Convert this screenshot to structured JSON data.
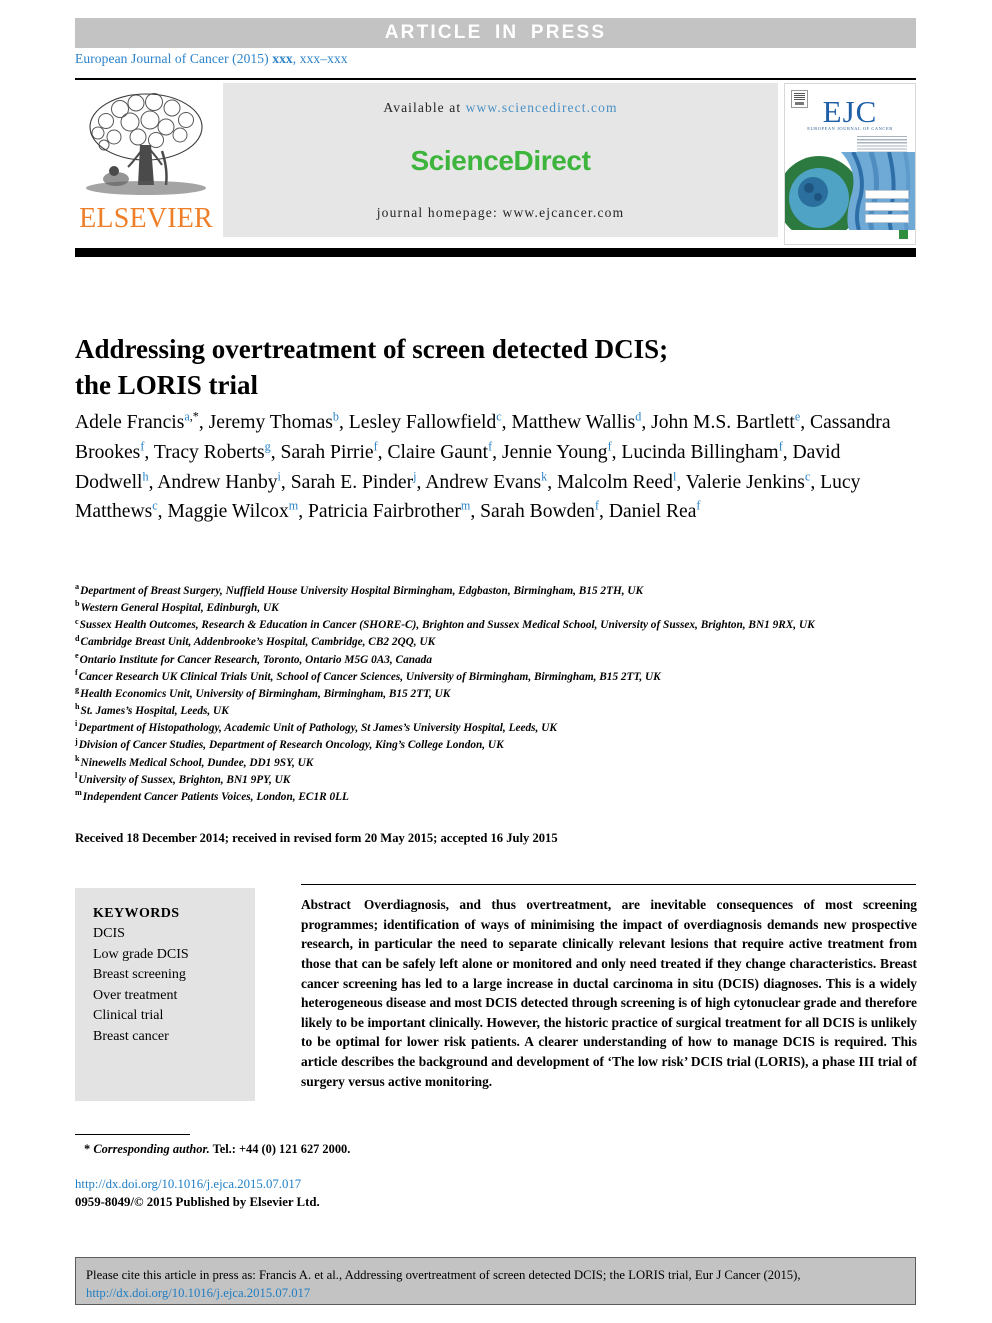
{
  "banner": {
    "text": "ARTICLE  IN  PRESS"
  },
  "journal_ref": {
    "prefix": "European Journal of Cancer (2015) ",
    "bold": "xxx",
    "suffix": ", xxx–xxx"
  },
  "masthead": {
    "publisher": "ELSEVIER",
    "available_label": "Available at ",
    "available_url": "www.sciencedirect.com",
    "sciencedirect_logo": "ScienceDirect",
    "homepage": "journal homepage: www.ejcancer.com",
    "cover": {
      "title": "EJC",
      "subtitle": "EUROPEAN JOURNAL OF CANCER"
    },
    "colors": {
      "elsevier_orange": "#ee7f28",
      "sciencedirect_green": "#3db53d",
      "link_blue": "#4a90c4",
      "ejc_blue": "#1f5fa8",
      "banner_grey": "#c3c3c3",
      "panel_grey": "#e6e6e6"
    }
  },
  "article": {
    "title_line1": "Addressing overtreatment of screen detected DCIS;",
    "title_line2": "the LORIS trial"
  },
  "authors": [
    {
      "name": "Adele Francis",
      "sup": "a",
      "star": true
    },
    {
      "name": "Jeremy Thomas",
      "sup": "b"
    },
    {
      "name": "Lesley Fallowfield",
      "sup": "c"
    },
    {
      "name": "Matthew Wallis",
      "sup": "d"
    },
    {
      "name": "John M.S. Bartlett",
      "sup": "e"
    },
    {
      "name": "Cassandra Brookes",
      "sup": "f"
    },
    {
      "name": "Tracy Roberts",
      "sup": "g"
    },
    {
      "name": "Sarah Pirrie",
      "sup": "f"
    },
    {
      "name": "Claire Gaunt",
      "sup": "f"
    },
    {
      "name": "Jennie Young",
      "sup": "f"
    },
    {
      "name": "Lucinda Billingham",
      "sup": "f"
    },
    {
      "name": "David Dodwell",
      "sup": "h"
    },
    {
      "name": "Andrew Hanby",
      "sup": "i"
    },
    {
      "name": "Sarah E. Pinder",
      "sup": "j"
    },
    {
      "name": "Andrew Evans",
      "sup": "k"
    },
    {
      "name": "Malcolm Reed",
      "sup": "l"
    },
    {
      "name": "Valerie Jenkins",
      "sup": "c"
    },
    {
      "name": "Lucy Matthews",
      "sup": "c"
    },
    {
      "name": "Maggie Wilcox",
      "sup": "m"
    },
    {
      "name": "Patricia Fairbrother",
      "sup": "m"
    },
    {
      "name": "Sarah Bowden",
      "sup": "f"
    },
    {
      "name": "Daniel Rea",
      "sup": "f"
    }
  ],
  "affiliations": [
    {
      "key": "a",
      "text": "Department of Breast Surgery, Nuffield House University Hospital Birmingham, Edgbaston, Birmingham, B15 2TH, UK"
    },
    {
      "key": "b",
      "text": "Western General Hospital, Edinburgh, UK"
    },
    {
      "key": "c",
      "text": "Sussex Health Outcomes, Research & Education in Cancer (SHORE-C), Brighton and Sussex Medical School, University of Sussex, Brighton, BN1 9RX, UK"
    },
    {
      "key": "d",
      "text": "Cambridge Breast Unit, Addenbrooke’s Hospital, Cambridge, CB2 2QQ, UK"
    },
    {
      "key": "e",
      "text": "Ontario Institute for Cancer Research, Toronto, Ontario M5G 0A3, Canada"
    },
    {
      "key": "f",
      "text": "Cancer Research UK Clinical Trials Unit, School of Cancer Sciences, University of Birmingham, Birmingham, B15 2TT, UK"
    },
    {
      "key": "g",
      "text": "Health Economics Unit, University of Birmingham, Birmingham, B15 2TT, UK"
    },
    {
      "key": "h",
      "text": "St. James’s Hospital, Leeds, UK"
    },
    {
      "key": "i",
      "text": "Department of Histopathology, Academic Unit of Pathology, St James’s University Hospital, Leeds, UK"
    },
    {
      "key": "j",
      "text": "Division of Cancer Studies, Department of Research Oncology, King’s College London, UK"
    },
    {
      "key": "k",
      "text": "Ninewells Medical School, Dundee, DD1 9SY, UK"
    },
    {
      "key": "l",
      "text": "University of Sussex, Brighton, BN1 9PY, UK"
    },
    {
      "key": "m",
      "text": "Independent Cancer Patients Voices, London, EC1R 0LL"
    }
  ],
  "history": "Received 18 December 2014; received in revised form 20 May 2015; accepted 16 July 2015",
  "keywords": {
    "title": "KEYWORDS",
    "items": [
      "DCIS",
      "Low grade DCIS",
      "Breast screening",
      "Over treatment",
      "Clinical trial",
      "Breast cancer"
    ]
  },
  "abstract": {
    "label": "Abstract",
    "text": "Overdiagnosis, and thus overtreatment, are inevitable consequences of most screening programmes; identification of ways of minimising the impact of overdiagnosis demands new prospective research, in particular the need to separate clinically relevant lesions that require active treatment from those that can be safely left alone or monitored and only need treated if they change characteristics. Breast cancer screening has led to a large increase in ductal carcinoma in situ (DCIS) diagnoses. This is a widely heterogeneous disease and most DCIS detected through screening is of high cytonuclear grade and therefore likely to be important clinically. However, the historic practice of surgical treatment for all DCIS is unlikely to be optimal for lower risk patients. A clearer understanding of how to manage DCIS is required. This article describes the background and development of ‘The low risk’ DCIS trial (LORIS), a phase III trial of surgery versus active monitoring."
  },
  "footnote": {
    "star": "*",
    "label": "Corresponding author.",
    "tel": " Tel.: +44 (0) 121 627 2000."
  },
  "doi": "http://dx.doi.org/10.1016/j.ejca.2015.07.017",
  "issn": "0959-8049/© 2015 Published by Elsevier Ltd.",
  "citation": {
    "text": "Please cite this article in press as: Francis A. et al., Addressing overtreatment of screen detected DCIS; the LORIS trial, Eur J Cancer (2015),",
    "doi": "http://dx.doi.org/10.1016/j.ejca.2015.07.017"
  }
}
